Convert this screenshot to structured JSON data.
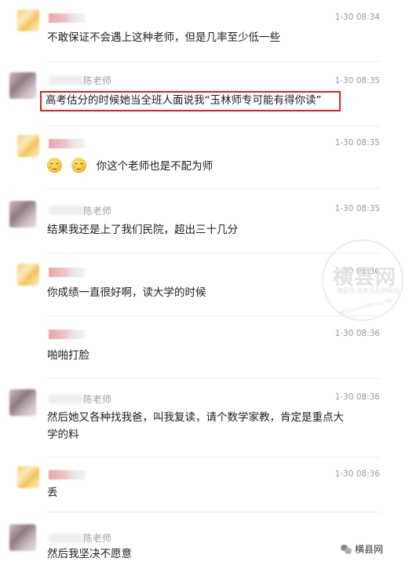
{
  "comments": [
    {
      "id": "c1",
      "author_label": "",
      "time": "1-30 08:34",
      "text": "不敢保证不会遇上这种老师，但是几率至少低一些"
    },
    {
      "id": "c2",
      "author_label": "陈老师",
      "time": "1-30 08:35",
      "text": "高考估分的时候她当全班人面说我“玉林师专可能有得你读”"
    },
    {
      "id": "c3",
      "author_label": "",
      "time": "1-30 08:35",
      "text": "你这个老师也是不配为师",
      "emoji_count": 2
    },
    {
      "id": "c4",
      "author_label": "陈老师",
      "time": "1-30 08:35",
      "text": "结果我还是上了我们民院，超出三十几分"
    },
    {
      "id": "c5",
      "author_label": "",
      "time": "1-30 08:36",
      "text": "你成绩一直很好啊，读大学的时候"
    },
    {
      "id": "c6",
      "author_label": "",
      "time": "1-30 08:36",
      "text": "啪啪打脸"
    },
    {
      "id": "c7",
      "author_label": "陈老师",
      "time": "1-30 08:36",
      "text_line1": "然后她又各种找我爸，叫我复读，请个数学家教，肯定是重点大",
      "text_line2": "学的料"
    },
    {
      "id": "c8",
      "author_label": "",
      "time": "1-30 08:36",
      "text": "丢"
    },
    {
      "id": "c9",
      "author_label": "陈老师",
      "time": "",
      "text": "然后我坚决不愿意"
    }
  ],
  "watermark": {
    "title": "横县网",
    "subtitle": "横县生活资讯品牌网站",
    "url": "HENGXIANWANG.NET"
  },
  "footer": {
    "brand": "横县网"
  },
  "colors": {
    "highlight_border": "#e02020",
    "text": "#1e1e1e",
    "time": "#9a9a9a"
  }
}
